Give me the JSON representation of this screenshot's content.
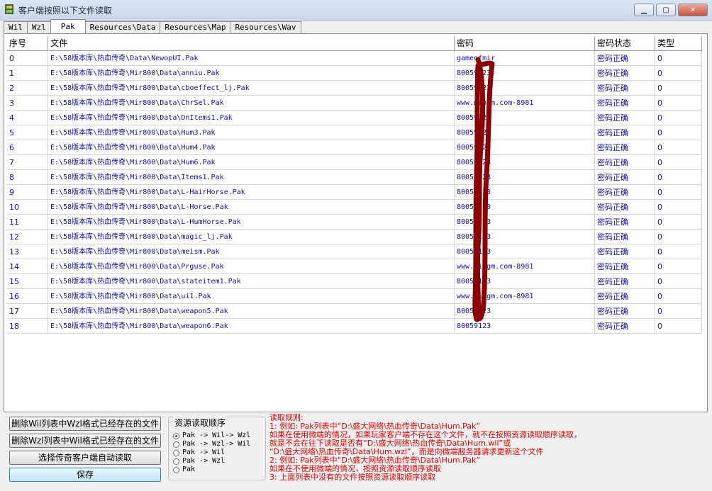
{
  "window": {
    "title": "客户端按照以下文件读取"
  },
  "tabs": [
    "Wil",
    "Wzl",
    "Pak",
    "Resources\\Data",
    "Resources\\Map",
    "Resources\\Wav"
  ],
  "active_tab": 2,
  "table": {
    "columns": [
      "序号",
      "文件",
      "密码",
      "密码状态",
      "类型"
    ],
    "rows": [
      [
        "0",
        "E:\\58版本库\\热血传奇\\Data\\NewopUI.Pak",
        "gameofmir",
        "密码正确",
        "0"
      ],
      [
        "1",
        "E:\\58版本库\\热血传奇\\Mir800\\Data\\anniu.Pak",
        "80059123",
        "密码正确",
        "0"
      ],
      [
        "2",
        "E:\\58版本库\\热血传奇\\Mir800\\Data\\cboeffect_lj.Pak",
        "80059123",
        "密码正确",
        "0"
      ],
      [
        "3",
        "E:\\58版本库\\热血传奇\\Mir800\\Data\\ChrSel.Pak",
        "www.mingm.com-8981",
        "密码正确",
        "0"
      ],
      [
        "4",
        "E:\\58版本库\\热血传奇\\Mir800\\Data\\DnItems1.Pak",
        "80059123",
        "密码正确",
        "0"
      ],
      [
        "5",
        "E:\\58版本库\\热血传奇\\Mir800\\Data\\Hum3.Pak",
        "80059123",
        "密码正确",
        "0"
      ],
      [
        "6",
        "E:\\58版本库\\热血传奇\\Mir800\\Data\\Hum4.Pak",
        "80059123",
        "密码正确",
        "0"
      ],
      [
        "7",
        "E:\\58版本库\\热血传奇\\Mir800\\Data\\Hum6.Pak",
        "80059123",
        "密码正确",
        "0"
      ],
      [
        "8",
        "E:\\58版本库\\热血传奇\\Mir800\\Data\\Items1.Pak",
        "80059123",
        "密码正确",
        "0"
      ],
      [
        "9",
        "E:\\58版本库\\热血传奇\\Mir800\\Data\\L-HairHorse.Pak",
        "80059123",
        "密码正确",
        "0"
      ],
      [
        "10",
        "E:\\58版本库\\热血传奇\\Mir800\\Data\\L-Horse.Pak",
        "80059123",
        "密码正确",
        "0"
      ],
      [
        "11",
        "E:\\58版本库\\热血传奇\\Mir800\\Data\\L-HumHorse.Pak",
        "80059123",
        "密码正确",
        "0"
      ],
      [
        "12",
        "E:\\58版本库\\热血传奇\\Mir800\\Data\\magic_lj.Pak",
        "80059123",
        "密码正确",
        "0"
      ],
      [
        "13",
        "E:\\58版本库\\热血传奇\\Mir800\\Data\\meism.Pak",
        "80059123",
        "密码正确",
        "0"
      ],
      [
        "14",
        "E:\\58版本库\\热血传奇\\Mir800\\Data\\Prguse.Pak",
        "www.mingm.com-8981",
        "密码正确",
        "0"
      ],
      [
        "15",
        "E:\\58版本库\\热血传奇\\Mir800\\Data\\stateitem1.Pak",
        "80059123",
        "密码正确",
        "0"
      ],
      [
        "16",
        "E:\\58版本库\\热血传奇\\Mir800\\Data\\ui1.Pak",
        "www.mingm.com-8981",
        "密码正确",
        "0"
      ],
      [
        "17",
        "E:\\58版本库\\热血传奇\\Mir800\\Data\\weapon5.Pak",
        "80059123",
        "密码正确",
        "0"
      ],
      [
        "18",
        "E:\\58版本库\\热血传奇\\Mir800\\Data\\weapon6.Pak",
        "80059123",
        "密码正确",
        "0"
      ]
    ]
  },
  "buttons": {
    "delete_wil": "删除Wil列表中Wzl格式已经存在的文件",
    "delete_wzl": "删除Wzl列表中Wil格式已经存在的文件",
    "select_client": "选择传奇客户端自动读取",
    "save": "保存"
  },
  "read_order": {
    "title": "资源读取顺序",
    "selected": 0,
    "options": [
      "Pak -> Wil-> Wzl",
      "Pak -> Wzl-> Wil",
      "Pak -> Wil",
      "Pak -> Wzl",
      "Pak"
    ]
  },
  "rules": [
    "读取规则:",
    "1: 例如: Pak列表中“D:\\盛大网络\\热血传奇\\Data\\Hum.Pak”",
    "    如果在使用微端的情况，如果玩家客户端不存在这个文件，就不在按照资源读取顺序读取，",
    "    就是不会在往下读取是否有“D:\\盛大网络\\热血传奇\\Data\\Hum.wil”或",
    "    “D:\\盛大网络\\热血传奇\\Data\\Hum.wzl”，而是向微端服务器请求更新这个文件",
    "2: 例如: Pak列表中“D:\\盛大网络\\热血传奇\\Data\\Hum.Pak”",
    "    如果在不使用微端的情况，按照资源读取顺序读取",
    "3: 上面列表中没有的文件按照资源读取顺序读取"
  ],
  "colors": {
    "cell_text": "#1010a0",
    "rules_text": "#e00000",
    "scribble": "#8b0000"
  }
}
